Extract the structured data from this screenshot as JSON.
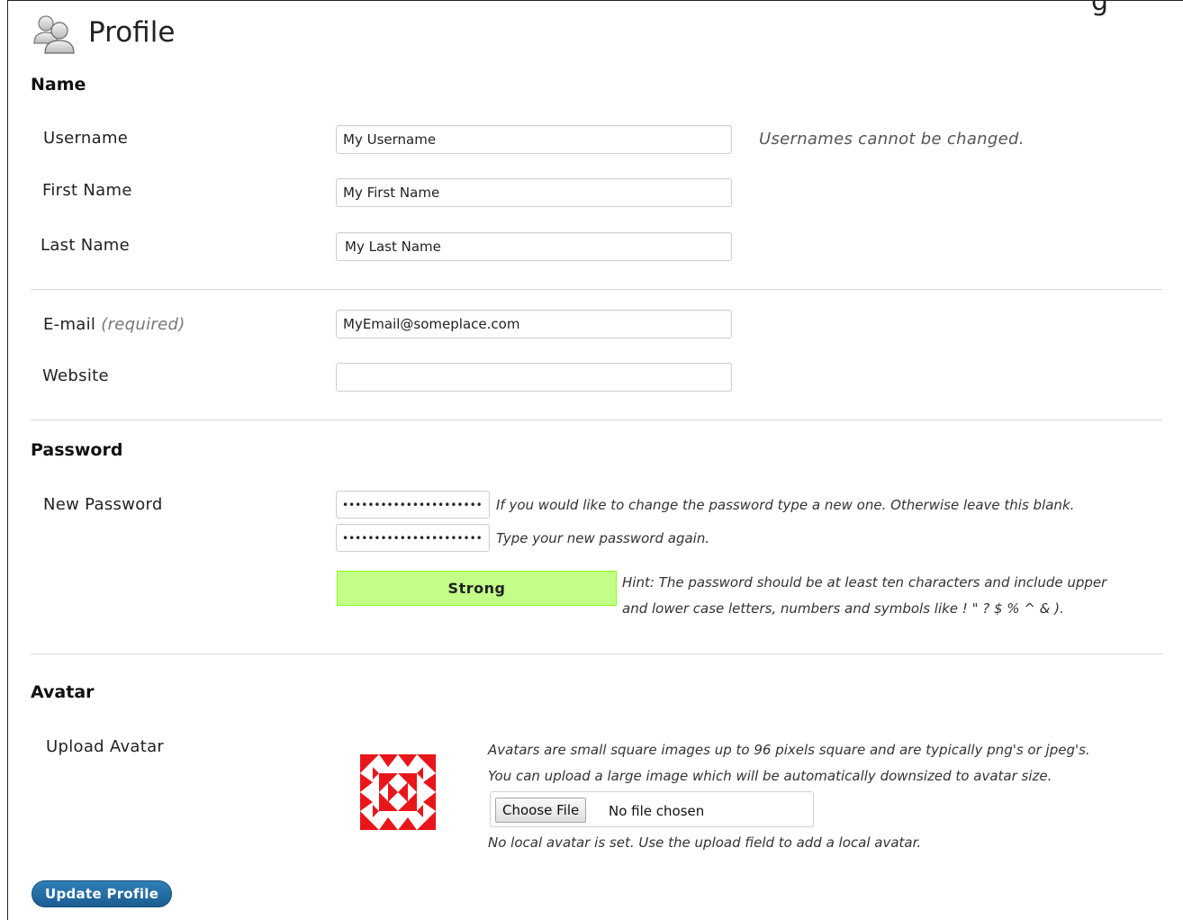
{
  "page": {
    "title": "Profile",
    "icon": "users-icon"
  },
  "sections": {
    "name": "Name",
    "password": "Password",
    "avatar": "Avatar"
  },
  "fields": {
    "username": {
      "label": "Username",
      "value": "My Username",
      "note": "Usernames cannot be changed."
    },
    "first_name": {
      "label": "First Name",
      "value": "My First Name"
    },
    "last_name": {
      "label": "Last Name",
      "value": "My Last Name"
    },
    "email": {
      "label": "E-mail",
      "required_note": "(required)",
      "value": "MyEmail@someplace.com"
    },
    "website": {
      "label": "Website",
      "value": ""
    }
  },
  "password": {
    "label": "New Password",
    "value1": "••••••••••••••••••••••",
    "value2": "••••••••••••••••••••••",
    "help1": "If you would like to change the password type a new one. Otherwise leave this blank.",
    "help2": "Type your new password again.",
    "strength": "Strong",
    "strength_color": "#c3ff88",
    "hint_line1": "Hint: The password should be at least ten characters and include upper",
    "hint_line2": "and lower case letters, numbers and symbols like ! \" ? $ % ^ & )."
  },
  "avatar": {
    "label": "Upload Avatar",
    "image": "identicon-avatar",
    "desc1": "Avatars are small square images up to 96 pixels square and are typically png's or jpeg's.",
    "desc2": "You can upload a large image which will be automatically downsized to avatar size.",
    "choose_label": "Choose File",
    "no_file": "No file chosen",
    "status": "No local avatar is set. Use the upload field to add a local avatar."
  },
  "actions": {
    "update_label": "Update Profile"
  },
  "colors": {
    "accent": "#1b5d92",
    "strength_border": "#8dff1c",
    "identicon": "#e8161b"
  }
}
